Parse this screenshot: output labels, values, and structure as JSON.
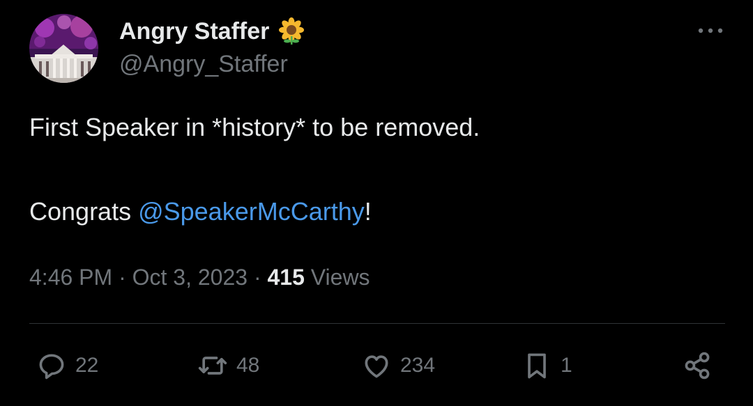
{
  "author": {
    "name": "Angry Staffer",
    "handle": "@Angry_Staffer",
    "badge_icon": "sunflower-icon",
    "avatar_icon": "white-house-fireworks-avatar"
  },
  "tweet": {
    "line1": "First Speaker in *history* to be removed.",
    "line2_prefix": "Congrats ",
    "mention": "@SpeakerMcCarthy",
    "line2_suffix": "!"
  },
  "meta": {
    "time": "4:46 PM",
    "date": "Oct 3, 2023",
    "views_count": "415",
    "views_label": "Views",
    "separator": "·"
  },
  "actions": [
    {
      "icon": "reply-icon",
      "count": "22"
    },
    {
      "icon": "retweet-icon",
      "count": "48"
    },
    {
      "icon": "like-icon",
      "count": "234"
    },
    {
      "icon": "bookmark-icon",
      "count": "1"
    },
    {
      "icon": "share-icon",
      "count": ""
    }
  ],
  "colors": {
    "background": "#000000",
    "text": "#e7e9ea",
    "secondary": "#71767b",
    "link": "#4a99e9",
    "divider": "#2f3336"
  }
}
